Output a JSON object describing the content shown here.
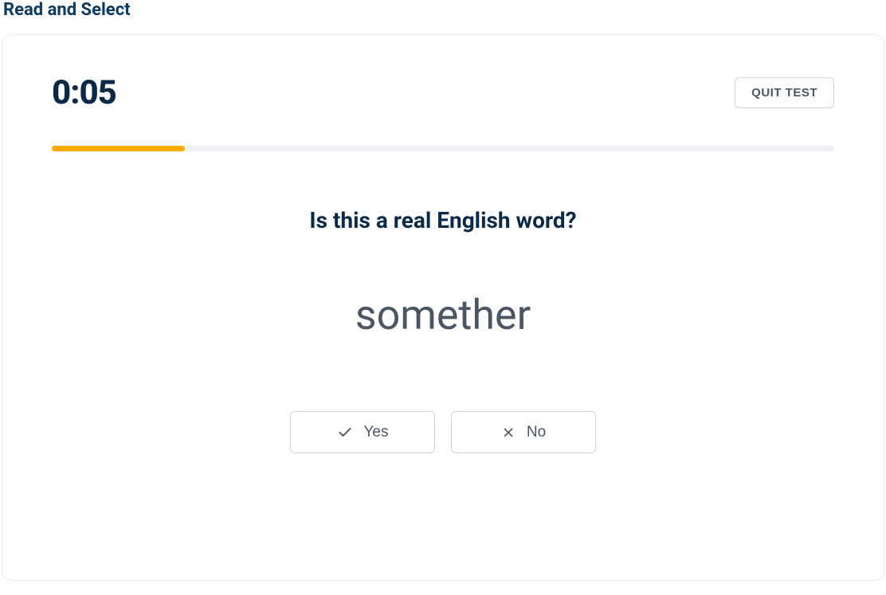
{
  "page": {
    "title": "Read and Select"
  },
  "timer": {
    "display": "0:05"
  },
  "actions": {
    "quit_label": "QUIT TEST"
  },
  "progress": {
    "percent": 17
  },
  "question": {
    "prompt": "Is this a real English word?",
    "word": "somether"
  },
  "buttons": {
    "yes_label": "Yes",
    "no_label": "No"
  }
}
